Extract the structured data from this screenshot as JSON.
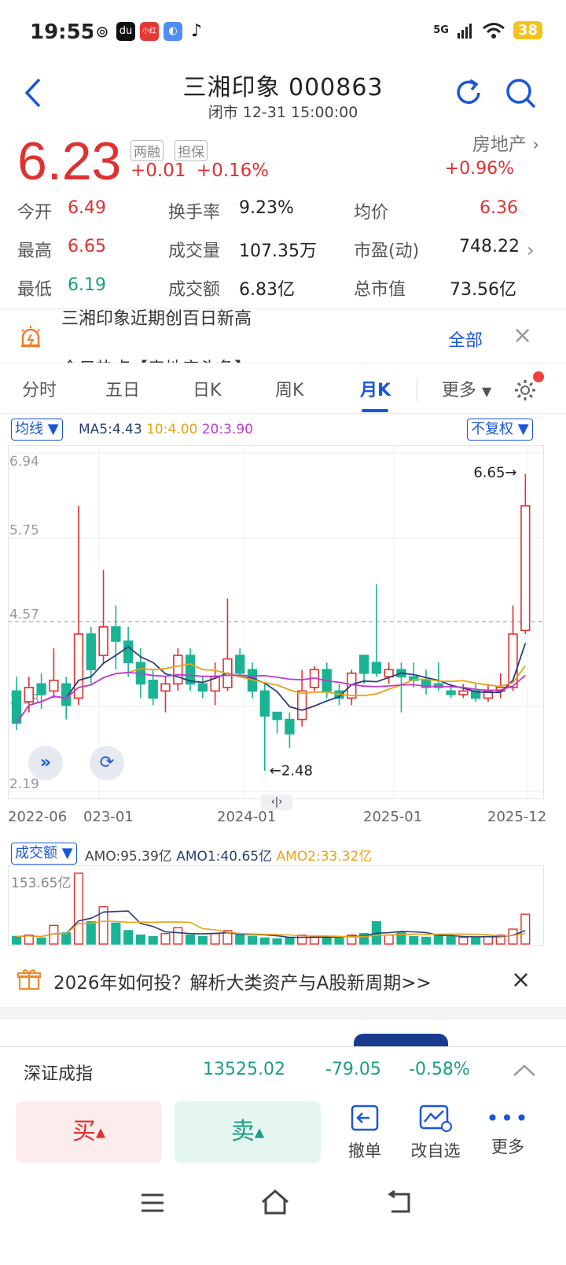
{
  "status_bar": {
    "time": "19:55",
    "network": "5G",
    "battery": "38"
  },
  "header": {
    "title": "三湘印象 000863",
    "subtitle": "闭市 12-31 15:00:00"
  },
  "quote": {
    "price": "6.23",
    "change": "+0.01",
    "change_pct": "+0.16%",
    "tag1": "两融",
    "tag2": "担保",
    "sector": "房地产",
    "sector_change": "+0.96%"
  },
  "stats": {
    "open_label": "今开",
    "open": "6.49",
    "high_label": "最高",
    "high": "6.65",
    "low_label": "最低",
    "low": "6.19",
    "turnover_label": "换手率",
    "turnover": "9.23%",
    "volume_label": "成交量",
    "volume": "107.35万",
    "amount_label": "成交额",
    "amount": "6.83亿",
    "avg_label": "均价",
    "avg": "6.36",
    "pe_label": "市盈(动)",
    "pe": "748.22",
    "mktcap_label": "总市值",
    "mktcap": "73.56亿"
  },
  "news": {
    "line1": "三湘印象近期创百日新高",
    "line2": "今日热点【房地产头条】",
    "all_label": "全部"
  },
  "tabs": [
    "分时",
    "五日",
    "日K",
    "周K",
    "月K"
  ],
  "more_tab": "更多",
  "chart_controls": {
    "ma_chip": "均线",
    "ma5": "MA5:4.43",
    "ma10": "10:4.00",
    "ma20": "20:3.90",
    "adjust_chip": "不复权",
    "vol_chip": "成交额",
    "amo": "AMO:95.39亿",
    "amo1": "AMO1:40.65亿",
    "amo2": "AMO2:33.32亿",
    "vol_max": "153.65亿"
  },
  "colors": {
    "up": "#e03131",
    "down": "#1ab394",
    "ma5": "#2c3e77",
    "ma10": "#e8a317",
    "ma20": "#c03ad1",
    "accent": "#1a56db"
  },
  "chart_data": {
    "type": "candlestick",
    "y_ticks": [
      "6.94",
      "5.75",
      "4.57",
      "3.38",
      "2.19"
    ],
    "ylim": [
      2.19,
      6.94
    ],
    "x_ticks": [
      "2022-06",
      "023-01",
      "2024-01",
      "2025-01",
      "2025-12"
    ],
    "high_label": "6.65→",
    "low_label": "←2.48",
    "candles": [
      {
        "o": 3.6,
        "c": 3.15,
        "h": 3.8,
        "l": 3.05
      },
      {
        "o": 3.45,
        "c": 3.65,
        "h": 3.8,
        "l": 3.3
      },
      {
        "o": 3.7,
        "c": 3.55,
        "h": 3.85,
        "l": 3.35
      },
      {
        "o": 3.6,
        "c": 3.75,
        "h": 4.2,
        "l": 3.5
      },
      {
        "o": 3.7,
        "c": 3.4,
        "h": 3.8,
        "l": 3.2
      },
      {
        "o": 3.5,
        "c": 4.4,
        "h": 6.2,
        "l": 3.4
      },
      {
        "o": 4.4,
        "c": 3.9,
        "h": 4.5,
        "l": 3.7
      },
      {
        "o": 4.1,
        "c": 4.5,
        "h": 5.3,
        "l": 4.0
      },
      {
        "o": 4.5,
        "c": 4.3,
        "h": 4.8,
        "l": 3.9
      },
      {
        "o": 4.3,
        "c": 4.0,
        "h": 4.5,
        "l": 3.8
      },
      {
        "o": 4.0,
        "c": 3.7,
        "h": 4.2,
        "l": 3.5
      },
      {
        "o": 3.75,
        "c": 3.5,
        "h": 3.9,
        "l": 3.4
      },
      {
        "o": 3.6,
        "c": 3.7,
        "h": 3.8,
        "l": 3.3
      },
      {
        "o": 3.7,
        "c": 4.1,
        "h": 4.2,
        "l": 3.6
      },
      {
        "o": 4.1,
        "c": 3.7,
        "h": 4.2,
        "l": 3.6
      },
      {
        "o": 3.7,
        "c": 3.6,
        "h": 3.8,
        "l": 3.5
      },
      {
        "o": 3.6,
        "c": 3.8,
        "h": 4.0,
        "l": 3.4
      },
      {
        "o": 3.65,
        "c": 4.05,
        "h": 4.9,
        "l": 3.6
      },
      {
        "o": 4.1,
        "c": 3.85,
        "h": 4.2,
        "l": 3.8
      },
      {
        "o": 3.9,
        "c": 3.6,
        "h": 4.0,
        "l": 3.5
      },
      {
        "o": 3.6,
        "c": 3.25,
        "h": 3.7,
        "l": 2.48
      },
      {
        "o": 3.3,
        "c": 3.2,
        "h": 3.3,
        "l": 3.0
      },
      {
        "o": 3.2,
        "c": 3.0,
        "h": 3.3,
        "l": 2.8
      },
      {
        "o": 3.2,
        "c": 3.6,
        "h": 3.9,
        "l": 3.1
      },
      {
        "o": 3.65,
        "c": 3.9,
        "h": 3.95,
        "l": 3.6
      },
      {
        "o": 3.9,
        "c": 3.6,
        "h": 4.0,
        "l": 3.5
      },
      {
        "o": 3.6,
        "c": 3.5,
        "h": 3.7,
        "l": 3.4
      },
      {
        "o": 3.5,
        "c": 3.85,
        "h": 3.9,
        "l": 3.4
      },
      {
        "o": 4.1,
        "c": 3.85,
        "h": 4.1,
        "l": 3.7
      },
      {
        "o": 4.0,
        "c": 3.85,
        "h": 5.1,
        "l": 3.8
      },
      {
        "o": 3.8,
        "c": 3.9,
        "h": 4.0,
        "l": 3.7
      },
      {
        "o": 3.9,
        "c": 3.8,
        "h": 4.0,
        "l": 3.3
      },
      {
        "o": 3.8,
        "c": 3.75,
        "h": 4.0,
        "l": 3.65
      },
      {
        "o": 3.75,
        "c": 3.65,
        "h": 3.9,
        "l": 3.55
      },
      {
        "o": 3.7,
        "c": 3.65,
        "h": 4.0,
        "l": 3.6
      },
      {
        "o": 3.6,
        "c": 3.55,
        "h": 3.7,
        "l": 3.5
      },
      {
        "o": 3.55,
        "c": 3.6,
        "h": 3.7,
        "l": 3.5
      },
      {
        "o": 3.6,
        "c": 3.5,
        "h": 3.7,
        "l": 3.45
      },
      {
        "o": 3.5,
        "c": 3.6,
        "h": 3.7,
        "l": 3.45
      },
      {
        "o": 3.6,
        "c": 3.65,
        "h": 3.85,
        "l": 3.5
      },
      {
        "o": 3.65,
        "c": 4.4,
        "h": 4.8,
        "l": 3.6
      },
      {
        "o": 4.45,
        "c": 6.2,
        "h": 6.65,
        "l": 4.4
      }
    ],
    "volumes": [
      10,
      12,
      8,
      25,
      15,
      95,
      30,
      50,
      28,
      18,
      12,
      10,
      14,
      22,
      12,
      10,
      14,
      18,
      12,
      10,
      8,
      7,
      8,
      12,
      10,
      9,
      8,
      12,
      14,
      30,
      12,
      16,
      10,
      9,
      12,
      10,
      9,
      8,
      10,
      12,
      20,
      40
    ]
  },
  "banner": {
    "text": "2026年如何投？解析大类资产与A股新周期>>"
  },
  "index_ticker": {
    "name": "深证成指",
    "value": "13525.02",
    "change": "-79.05",
    "pct": "-0.58%"
  },
  "trade": {
    "buy": "买",
    "sell": "卖",
    "cancel": "撤单",
    "watch": "改自选",
    "more": "更多"
  }
}
